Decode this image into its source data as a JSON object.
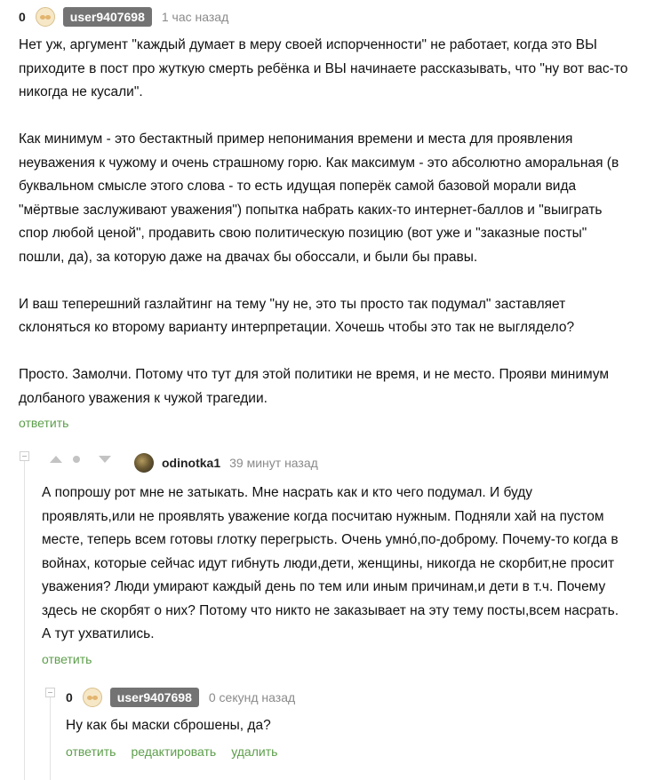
{
  "comment1": {
    "rating": "0",
    "username": "user9407698",
    "time": "1 час назад",
    "text": "Нет уж, аргумент \"каждый думает в меру своей испорченности\" не работает, когда это ВЫ\nприходите в пост про жуткую смерть ребёнка и ВЫ начинаете рассказывать, что \"ну вот вас-то\nникогда не кусали\".\n\nКак минимум - это бестактный пример непонимания времени и места для проявления\nнеуважения к чужому и очень страшному горю. Как максимум - это абсолютно аморальная (в\nбуквальном смысле этого слова - то есть идущая поперёк самой базовой морали вида\n\"мёртвые заслуживают уважения\") попытка набрать каких-то интернет-баллов и \"выиграть\nспор любой ценой\", продавить свою политическую позицию (вот уже и \"заказные посты\"\nпошли, да), за которую даже на двачах бы обоссали, и были бы правы.\n\nИ ваш теперешний газлайтинг на тему \"ну не, это ты просто так подумал\" заставляет\nсклоняться ко второму варианту интерпретации. Хочешь чтобы это так не выглядело?\n\nПросто. Замолчи. Потому что тут для этой политики не время, и не место. Прояви минимум\nдолбаного уважения к чужой трагедии.",
    "reply_label": "ответить"
  },
  "comment2": {
    "username": "odinotka1",
    "time": "39 минут назад",
    "text": "А попрошу рот мне не затыкать. Мне насрать как и кто чего подумал. И буду\nпроявлять,или не проявлять уважение когда посчитаю нужным. Подняли хай на пустом\nместе, теперь всем готовы глотку перегрысть. Очень умно́,по-доброму. Почему-то когда в\nвойнах, которые сейчас идут гибнуть люди,дети, женщины, никогда не скорбит,не просит\nуважения? Люди умирают каждый день по тем или иным причинам,и дети в т.ч. Почему\nздесь не скорбят о них? Потому что никто не заказывает на эту тему посты,всем насрать.\nА тут ухватились.",
    "reply_label": "ответить"
  },
  "comment3": {
    "rating": "0",
    "username": "user9407698",
    "time": "0 секунд назад",
    "text": "Ну как бы маски сброшены, да?",
    "reply_label": "ответить",
    "edit_label": "редактировать",
    "delete_label": "удалить"
  },
  "colors": {
    "link": "#5c9e4a",
    "username_badge": "#737373",
    "thread_line": "#e3e3e3",
    "vote_icon": "#c3c3c3"
  }
}
